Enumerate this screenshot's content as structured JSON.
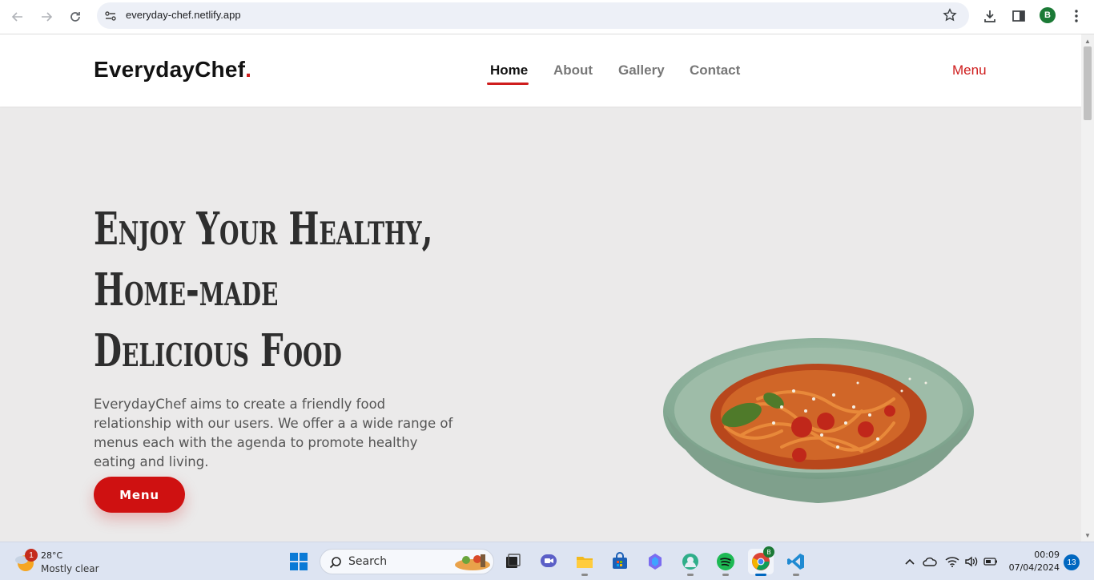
{
  "browser": {
    "url": "everyday-chef.netlify.app",
    "profile_initial": "B"
  },
  "site": {
    "brand_name": "EverydayChef",
    "brand_dot": ".",
    "nav": [
      {
        "label": "Home",
        "active": true
      },
      {
        "label": "About",
        "active": false
      },
      {
        "label": "Gallery",
        "active": false
      },
      {
        "label": "Contact",
        "active": false
      }
    ],
    "menu_link": "Menu",
    "accent_color": "#cf1d1d"
  },
  "hero": {
    "title_lines": [
      "Enjoy Your Healthy,",
      "Home-made",
      "Delicious Food"
    ],
    "description": "EverydayChef aims to create a friendly food relationship with our users. We offer a a wide range of menus each with the agenda to promote healthy eating and living.",
    "cta_label": "Menu"
  },
  "taskbar": {
    "weather_badge": "1",
    "temperature": "28°C",
    "condition": "Mostly clear",
    "search_label": "Search",
    "chrome_badge": "B",
    "time": "00:09",
    "date": "07/04/2024",
    "notification_count": "13"
  }
}
